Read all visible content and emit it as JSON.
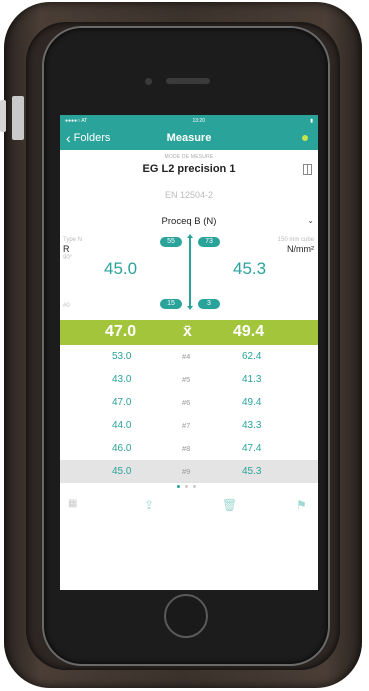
{
  "status": {
    "left": "●●●●○ AT",
    "time": "13:20",
    "right": "▮"
  },
  "nav": {
    "back_label": "Folders",
    "title": "Measure"
  },
  "header": {
    "small_label": "MODE DE MESURE",
    "title": "EG L2 precision 1",
    "standard": "EN 12504-2",
    "device": "Proceq B (N)"
  },
  "measurement": {
    "type_label": "Type N",
    "type_value": "R",
    "angle": "90°",
    "left_value": "45.0",
    "right_value": "45.3",
    "top_left_pill": "55",
    "top_right_pill": "73",
    "bottom_left_pill": "15",
    "bottom_right_pill": "3",
    "curve_label": "150 mm cube",
    "unit": "N/mm²",
    "count_label": "#0"
  },
  "mean": {
    "left": "47.0",
    "symbol": "x̄",
    "right": "49.4"
  },
  "rows": [
    {
      "left": "53.0",
      "num": "#4",
      "right": "62.4"
    },
    {
      "left": "43.0",
      "num": "#5",
      "right": "41.3"
    },
    {
      "left": "47.0",
      "num": "#6",
      "right": "49.4"
    },
    {
      "left": "44.0",
      "num": "#7",
      "right": "43.3"
    },
    {
      "left": "46.0",
      "num": "#8",
      "right": "47.4"
    },
    {
      "left": "45.0",
      "num": "#9",
      "right": "45.3"
    }
  ],
  "toolbar": {
    "grid": "▦",
    "share": "⇪",
    "trash": "🗑",
    "flag": "⚑"
  },
  "colors": {
    "teal": "#2aa39b",
    "lime": "#a3c53c"
  }
}
